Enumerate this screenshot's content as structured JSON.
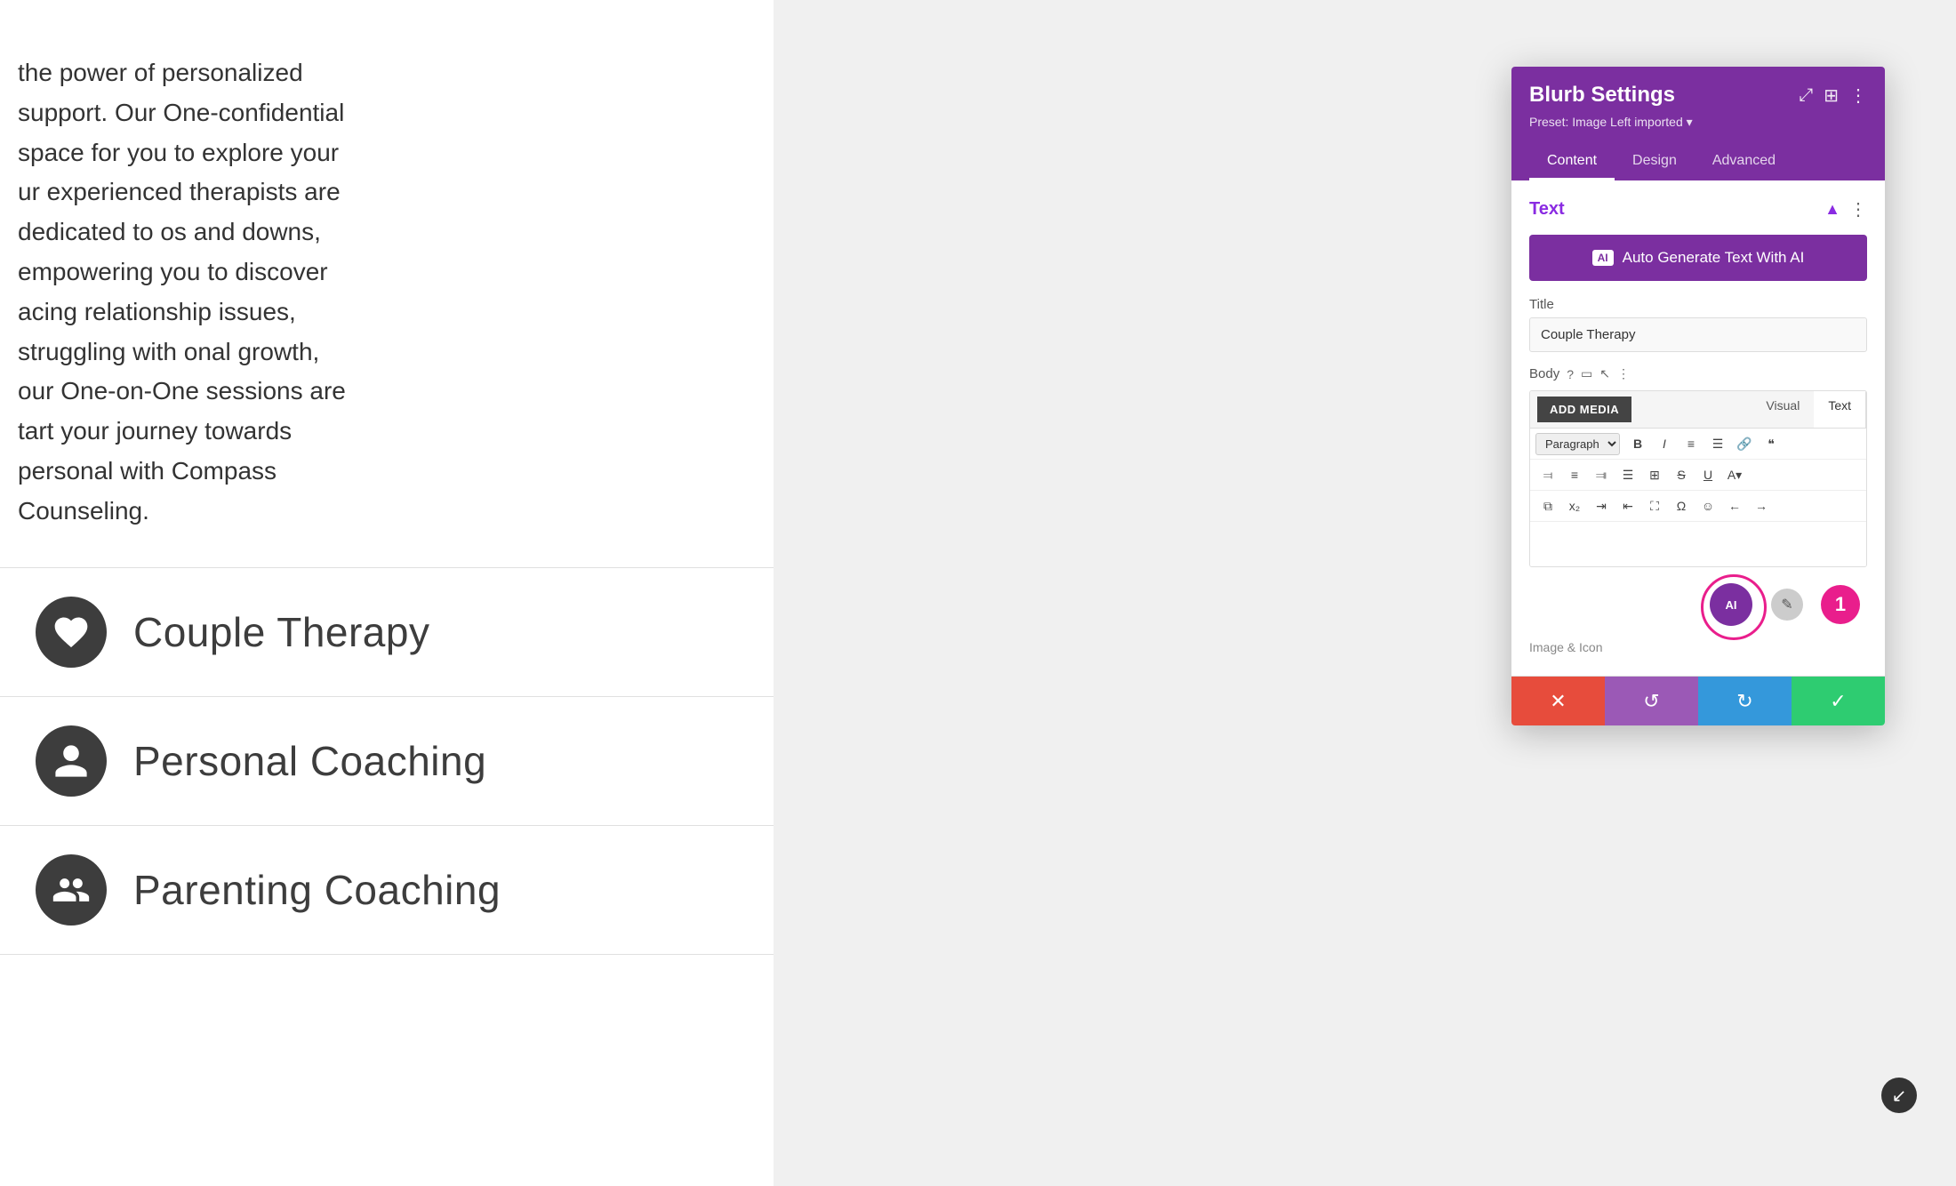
{
  "panel": {
    "title": "Blurb Settings",
    "preset": "Preset: Image Left imported ▾",
    "tabs": [
      "Content",
      "Design",
      "Advanced"
    ],
    "active_tab": "Content",
    "section": {
      "title": "Text",
      "ai_button_label": "Auto Generate Text With AI",
      "ai_badge": "AI",
      "title_label": "Title",
      "title_value": "Couple Therapy",
      "body_label": "Body",
      "add_media": "ADD MEDIA",
      "editor_tabs": [
        "Visual",
        "Text"
      ],
      "active_editor_tab": "Text",
      "paragraph_select": "Paragraph"
    },
    "bottom_bar": {
      "cancel": "✕",
      "undo": "↺",
      "redo": "↻",
      "save": "✓"
    }
  },
  "main": {
    "text_content": "the power of personalized support. Our One-confidential space for you to explore your ur experienced therapists are dedicated to os and downs, empowering you to discover acing relationship issues, struggling with onal growth, our One-on-One sessions are tart your journey towards personal with Compass Counseling.",
    "services": [
      {
        "label": "Couple Therapy",
        "icon": "heart"
      },
      {
        "label": "Personal Coaching",
        "icon": "person"
      },
      {
        "label": "Parenting Coaching",
        "icon": "family"
      }
    ]
  },
  "colors": {
    "purple_dark": "#7b2fa0",
    "purple_header": "#7b2fa0",
    "pink": "#e91e8c",
    "green": "#2ecc71",
    "blue": "#3498db",
    "red": "#e74c3c",
    "icon_bg": "#3d3d3d"
  },
  "badge_number": "1",
  "editor_tab_visual": "Visual",
  "editor_tab_text": "Text"
}
